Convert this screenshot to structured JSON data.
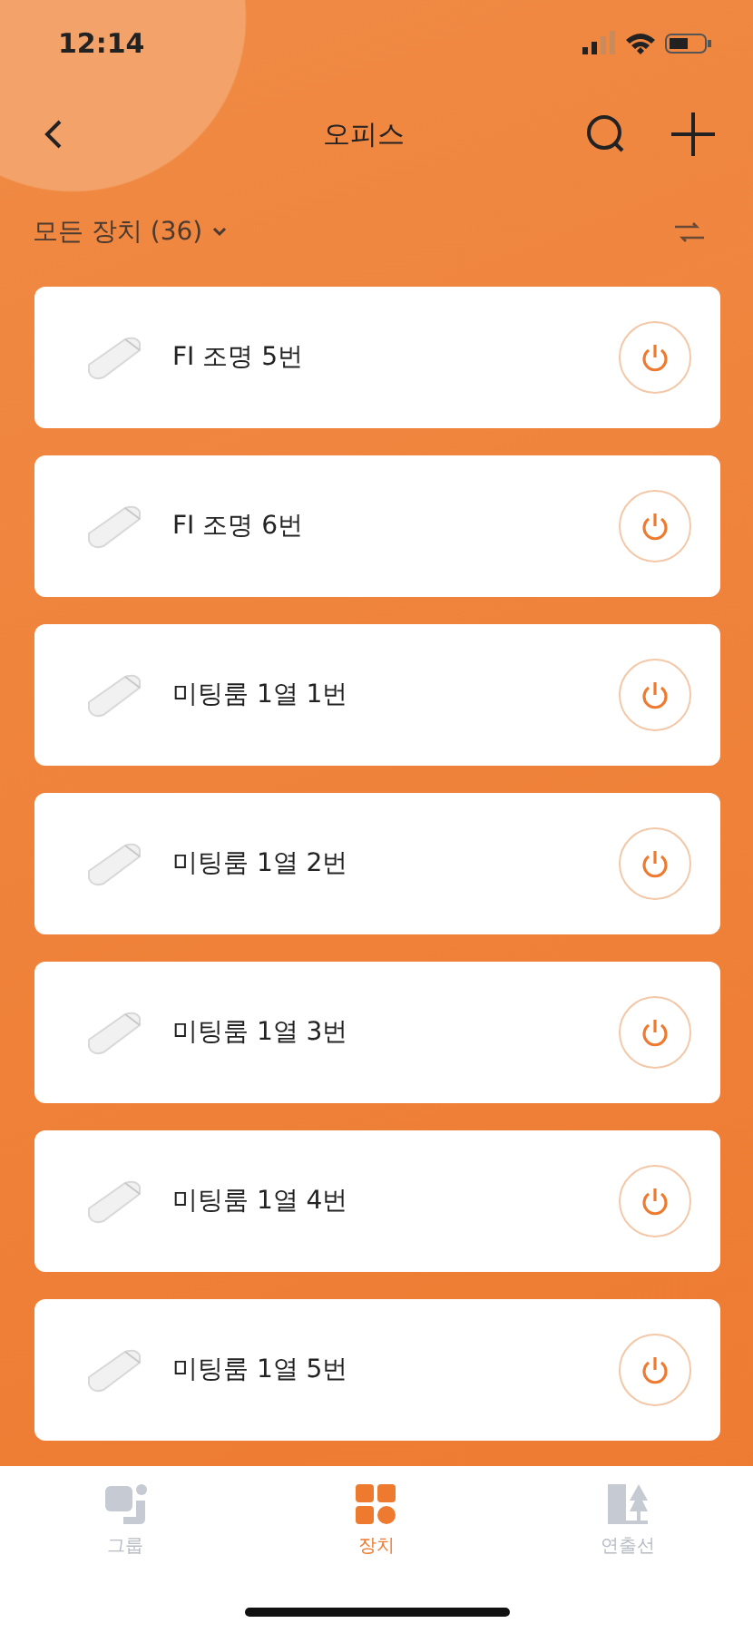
{
  "status_bar": {
    "time": "12:14"
  },
  "header": {
    "title": "오피스"
  },
  "filter": {
    "label": "모든 장치 (36)"
  },
  "devices": [
    {
      "name": "FI 조명 5번",
      "on": false
    },
    {
      "name": "FI 조명 6번",
      "on": false
    },
    {
      "name": "미팅룸 1열 1번",
      "on": false
    },
    {
      "name": "미팅룸 1열 2번",
      "on": false
    },
    {
      "name": "미팅룸 1열 3번",
      "on": false
    },
    {
      "name": "미팅룸 1열 4번",
      "on": false
    },
    {
      "name": "미팅룸 1열 5번",
      "on": false
    }
  ],
  "tabs": [
    {
      "label": "그룹",
      "kind": "group",
      "selected": false
    },
    {
      "label": "장치",
      "kind": "device",
      "selected": true
    },
    {
      "label": "연출선",
      "kind": "scene",
      "selected": false
    }
  ]
}
